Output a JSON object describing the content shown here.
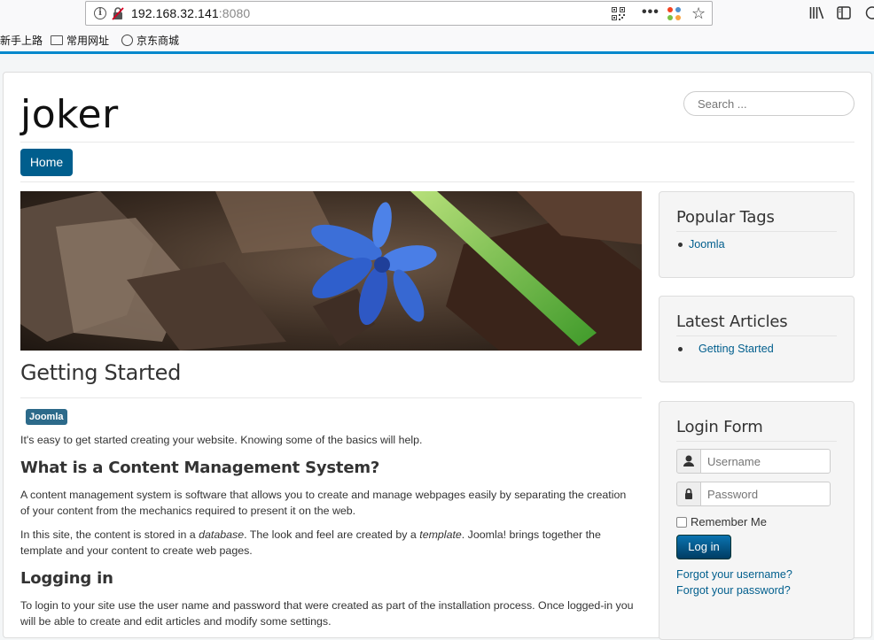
{
  "browser": {
    "url_host": "192.168.32.141",
    "url_port": ":8080",
    "bookmarks": [
      "新手上路",
      "常用网址",
      "京东商城"
    ]
  },
  "site": {
    "brand": "joker",
    "search_placeholder": "Search ...",
    "nav": [
      "Home"
    ]
  },
  "article": {
    "title": "Getting Started",
    "tag": "Joomla",
    "intro": "It's easy to get started creating your website. Knowing some of the basics will help.",
    "h_cms": "What is a Content Management System?",
    "p_cms": "A content management system is software that allows you to create and manage webpages easily by separating the creation of your content from the mechanics required to present it on the web.",
    "p_site_1": "In this site, the content is stored in a ",
    "p_site_em1": "database",
    "p_site_2": ". The look and feel are created by a ",
    "p_site_em2": "template",
    "p_site_3": ". Joomla! brings together the template and your content to create web pages.",
    "h_login": "Logging in",
    "p_login": "To login to your site use the user name and password that were created as part of the installation process. Once logged-in you will be able to create and edit articles and modify some settings."
  },
  "sidebar": {
    "popular_tags": {
      "title": "Popular Tags",
      "items": [
        "Joomla"
      ]
    },
    "latest_articles": {
      "title": "Latest Articles",
      "items": [
        "Getting Started"
      ]
    },
    "login_form": {
      "title": "Login Form",
      "username_placeholder": "Username",
      "password_placeholder": "Password",
      "remember": "Remember Me",
      "login_button": "Log in",
      "forgot_username": "Forgot your username?",
      "forgot_password": "Forgot your password?"
    }
  },
  "colors": {
    "accent": "#005e8d",
    "browser_accent": "#0088cc"
  }
}
